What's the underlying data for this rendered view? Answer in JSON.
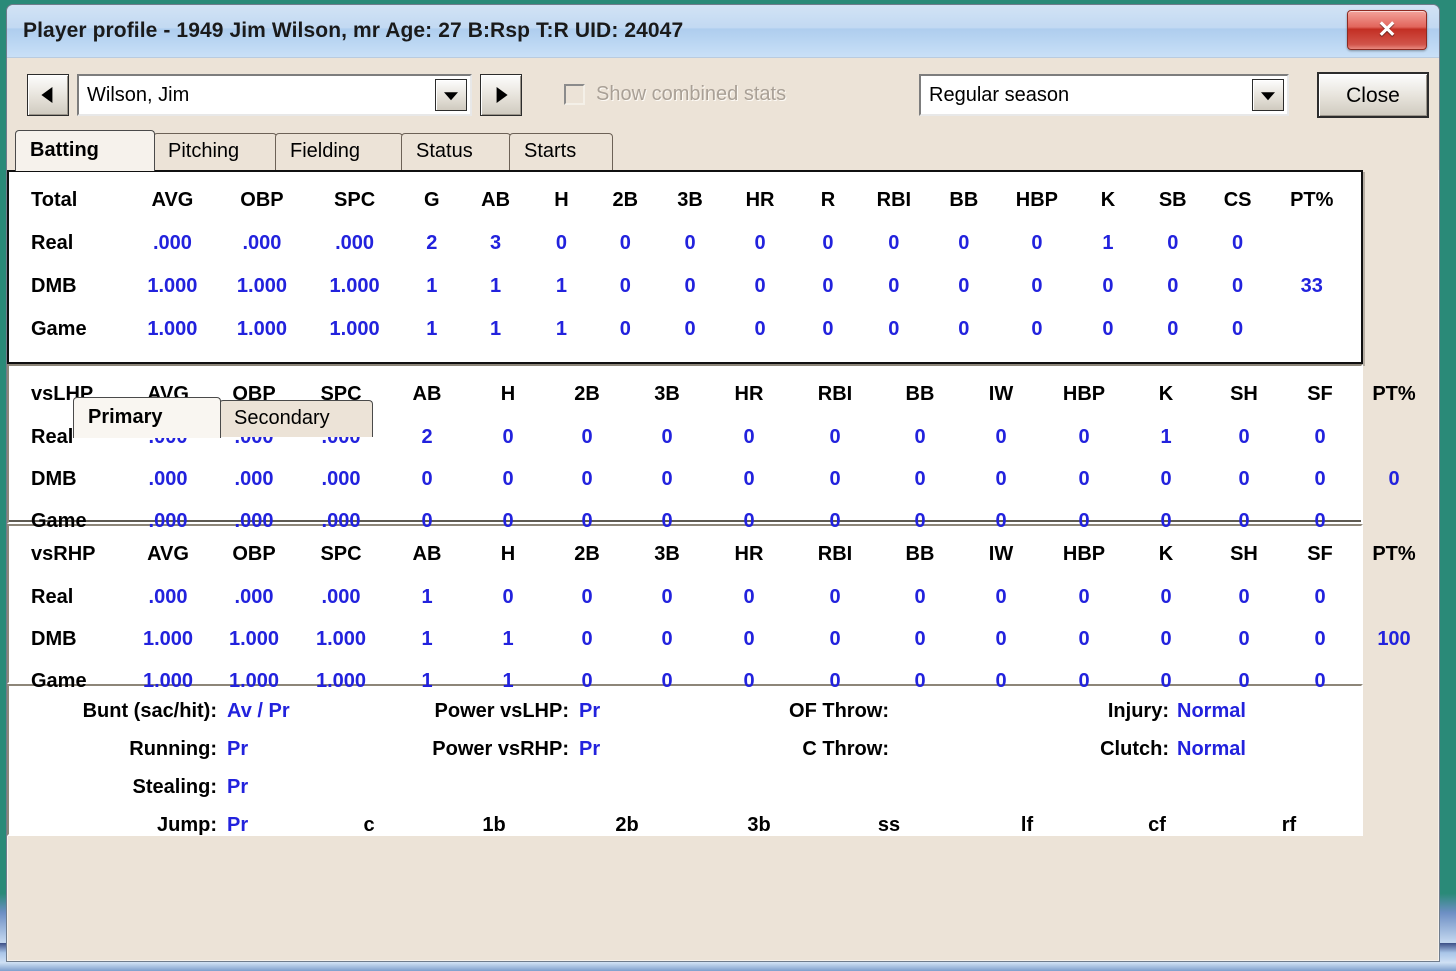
{
  "window": {
    "title": "Player profile - 1949 Jim Wilson, mr  Age: 27  B:Rsp T:R  UID: 24047",
    "close_glyph": "✕"
  },
  "toolbar": {
    "prev_label": "◀",
    "next_label": "▶",
    "player_value": "Wilson, Jim",
    "combined_checkbox_label": "Show combined stats",
    "season_value": "Regular season",
    "close_label": "Close"
  },
  "tabs": [
    {
      "label": "Batting",
      "active": true
    },
    {
      "label": "Pitching",
      "active": false
    },
    {
      "label": "Fielding",
      "active": false
    },
    {
      "label": "Status",
      "active": false
    },
    {
      "label": "Starts",
      "active": false
    }
  ],
  "subtabs": [
    {
      "label": "Primary",
      "active": true
    },
    {
      "label": "Secondary",
      "active": false
    }
  ],
  "total_table": {
    "columns": [
      "Total",
      "AVG",
      "OBP",
      "SPC",
      "G",
      "AB",
      "H",
      "2B",
      "3B",
      "HR",
      "R",
      "RBI",
      "BB",
      "HBP",
      "K",
      "SB",
      "CS",
      "PT%"
    ],
    "rows": [
      {
        "label": "Real",
        "values": [
          ".000",
          ".000",
          ".000",
          "2",
          "3",
          "0",
          "0",
          "0",
          "0",
          "0",
          "0",
          "0",
          "0",
          "1",
          "0",
          "0",
          ""
        ]
      },
      {
        "label": "DMB",
        "values": [
          "1.000",
          "1.000",
          "1.000",
          "1",
          "1",
          "1",
          "0",
          "0",
          "0",
          "0",
          "0",
          "0",
          "0",
          "0",
          "0",
          "0",
          "33"
        ]
      },
      {
        "label": "Game",
        "values": [
          "1.000",
          "1.000",
          "1.000",
          "1",
          "1",
          "1",
          "0",
          "0",
          "0",
          "0",
          "0",
          "0",
          "0",
          "0",
          "0",
          "0",
          ""
        ]
      }
    ]
  },
  "lhp_table": {
    "columns": [
      "vsLHP",
      "AVG",
      "OBP",
      "SPC",
      "AB",
      "H",
      "2B",
      "3B",
      "HR",
      "RBI",
      "BB",
      "IW",
      "HBP",
      "K",
      "SH",
      "SF",
      "PT%"
    ],
    "rows": [
      {
        "label": "Real",
        "values": [
          ".000",
          ".000",
          ".000",
          "2",
          "0",
          "0",
          "0",
          "0",
          "0",
          "0",
          "0",
          "0",
          "1",
          "0",
          "0",
          ""
        ]
      },
      {
        "label": "DMB",
        "values": [
          ".000",
          ".000",
          ".000",
          "0",
          "0",
          "0",
          "0",
          "0",
          "0",
          "0",
          "0",
          "0",
          "0",
          "0",
          "0",
          "0"
        ]
      },
      {
        "label": "Game",
        "values": [
          ".000",
          ".000",
          ".000",
          "0",
          "0",
          "0",
          "0",
          "0",
          "0",
          "0",
          "0",
          "0",
          "0",
          "0",
          "0",
          ""
        ]
      }
    ]
  },
  "rhp_table": {
    "columns": [
      "vsRHP",
      "AVG",
      "OBP",
      "SPC",
      "AB",
      "H",
      "2B",
      "3B",
      "HR",
      "RBI",
      "BB",
      "IW",
      "HBP",
      "K",
      "SH",
      "SF",
      "PT%"
    ],
    "rows": [
      {
        "label": "Real",
        "values": [
          ".000",
          ".000",
          ".000",
          "1",
          "0",
          "0",
          "0",
          "0",
          "0",
          "0",
          "0",
          "0",
          "0",
          "0",
          "0",
          ""
        ]
      },
      {
        "label": "DMB",
        "values": [
          "1.000",
          "1.000",
          "1.000",
          "1",
          "1",
          "0",
          "0",
          "0",
          "0",
          "0",
          "0",
          "0",
          "0",
          "0",
          "0",
          "100"
        ]
      },
      {
        "label": "Game",
        "values": [
          "1.000",
          "1.000",
          "1.000",
          "1",
          "1",
          "0",
          "0",
          "0",
          "0",
          "0",
          "0",
          "0",
          "0",
          "0",
          "0",
          ""
        ]
      }
    ]
  },
  "ratings": {
    "col1": [
      {
        "label": "Bunt (sac/hit):",
        "value": "Av / Pr"
      },
      {
        "label": "Running:",
        "value": "Pr"
      },
      {
        "label": "Stealing:",
        "value": "Pr"
      },
      {
        "label": "Jump:",
        "value": "Pr"
      }
    ],
    "col2": [
      {
        "label": "Power vsLHP:",
        "value": "Pr"
      },
      {
        "label": "Power vsRHP:",
        "value": "Pr"
      }
    ],
    "col3": [
      {
        "label": "OF Throw:",
        "value": ""
      },
      {
        "label": "C Throw:",
        "value": ""
      }
    ],
    "col4": [
      {
        "label": "Injury:",
        "value": "Normal"
      },
      {
        "label": "Clutch:",
        "value": "Normal"
      }
    ],
    "positions": [
      "c",
      "1b",
      "2b",
      "3b",
      "ss",
      "lf",
      "cf",
      "rf"
    ]
  },
  "colors": {
    "value_blue": "#2222dd",
    "window_bg": "#ece3d7",
    "title_gradient_top": "#d2e3f5",
    "close_red": "#c32f24",
    "desktop_teal": "#2a8a78"
  }
}
